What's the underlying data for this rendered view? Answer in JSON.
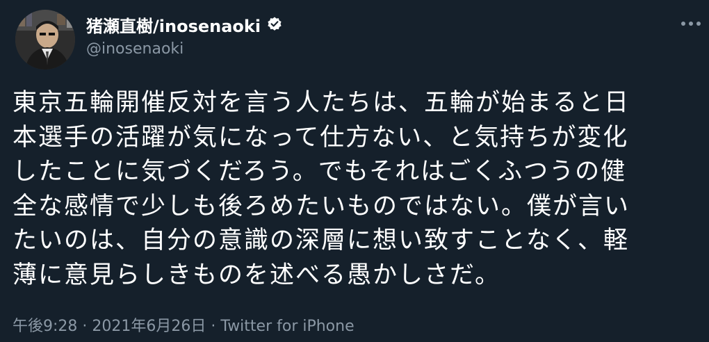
{
  "author": {
    "name": "猪瀬直樹/inosenaoki",
    "handle": "@inosenaoki",
    "verified": true
  },
  "tweet": {
    "lines": [
      "東京五輪開催反対を言う人たちは、五輪が始まると日",
      "本選手の活躍が気になって仕方ない、と気持ちが変化",
      "したことに気づくだろう。でもそれはごくふつうの健",
      "全な感情で少しも後ろめたいものではない。僕が言い",
      "たいのは、自分の意識の深層に想い致すことなく、軽",
      "薄に意見らしきものを述べる愚かしさだ。"
    ]
  },
  "meta": {
    "time": "午後9:28",
    "separator_1": "·",
    "date": "2021年6月26日",
    "separator_2": "·",
    "source": "Twitter for iPhone"
  },
  "icons": {
    "verified": "verified-badge-icon",
    "more": "more-dots-icon"
  },
  "colors": {
    "background": "#15202b",
    "text": "#ffffff",
    "secondary": "#8b98a5"
  }
}
